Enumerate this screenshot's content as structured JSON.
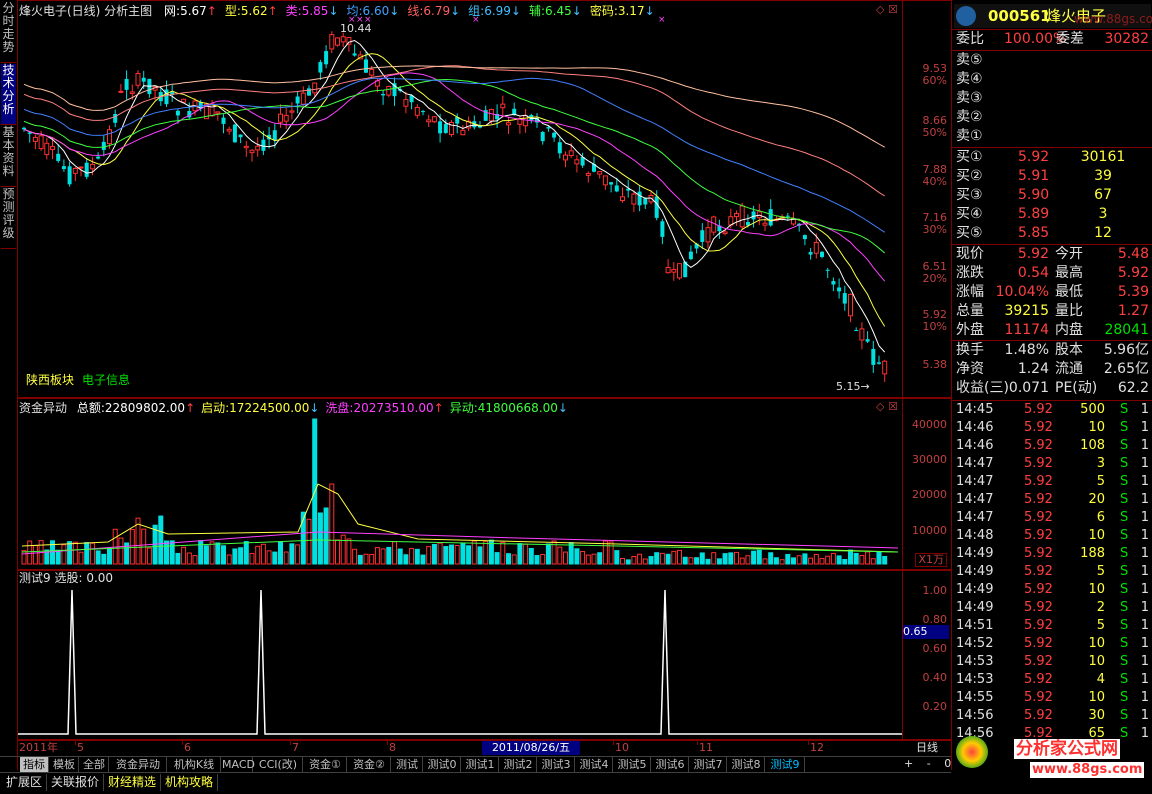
{
  "side_tabs": [
    "分时走势",
    "技术分析",
    "基本资料",
    "预测评级"
  ],
  "header": {
    "title": "烽火电子(日线) 分析主图",
    "items": [
      {
        "label": "网:",
        "value": "5.67",
        "arrow": "↑",
        "color": "#ffffff"
      },
      {
        "label": "型:",
        "value": "5.62",
        "arrow": "↑",
        "color": "#ffff40"
      },
      {
        "label": "类:",
        "value": "5.85",
        "arrow": "↓",
        "color": "#ff40ff"
      },
      {
        "label": "均:",
        "value": "6.60",
        "arrow": "↓",
        "color": "#40a0ff"
      },
      {
        "label": "线:",
        "value": "6.79",
        "arrow": "↓",
        "color": "#ff6060"
      },
      {
        "label": "组:",
        "value": "6.99",
        "arrow": "↓",
        "color": "#40c0ff"
      },
      {
        "label": "辅:",
        "value": "6.45",
        "arrow": "↓",
        "color": "#40ff40"
      },
      {
        "label": "密码:",
        "value": "3.17",
        "arrow": "↓",
        "color": "#ffff40"
      }
    ]
  },
  "main_chart": {
    "high_label": "10.44",
    "low_label": "5.15",
    "sector_label": "陕西板块",
    "industry_label": "电子信息",
    "price_axis": [
      {
        "price": "9.53",
        "pct": "60%"
      },
      {
        "price": "8.66",
        "pct": "50%"
      },
      {
        "price": "7.88",
        "pct": "40%"
      },
      {
        "price": "7.16",
        "pct": "30%"
      },
      {
        "price": "6.51",
        "pct": "20%"
      },
      {
        "price": "5.92",
        "pct": "10%"
      },
      {
        "price": "5.38",
        "pct": ""
      }
    ]
  },
  "volume_chart": {
    "title": "资金异动",
    "items": [
      {
        "label": "总额:",
        "value": "22809802.00",
        "arrow": "↑",
        "color": "#ffffff"
      },
      {
        "label": "启动:",
        "value": "17224500.00",
        "arrow": "↓",
        "color": "#ffff40"
      },
      {
        "label": "洗盘:",
        "value": "20273510.00",
        "arrow": "↑",
        "color": "#ff40ff"
      },
      {
        "label": "异动:",
        "value": "41800668.00",
        "arrow": "↓",
        "color": "#40ff40"
      }
    ],
    "axis": [
      "40000",
      "30000",
      "20000",
      "10000"
    ],
    "unit": "X1万"
  },
  "indicator_chart": {
    "title": "测试9",
    "select_label": "选股:",
    "select_value": "0.00",
    "axis": [
      "1.00",
      "0.80",
      "0.60",
      "0.40",
      "0.20"
    ],
    "cursor_value": "0.65"
  },
  "date_axis": {
    "labels": [
      "2011年",
      "5",
      "6",
      "7",
      "8",
      "10",
      "11",
      "12"
    ],
    "cursor_date": "2011/08/26/五",
    "period": "日线"
  },
  "indicator_tabs": [
    "指标",
    "模板",
    "全部",
    "资金异动",
    "机构K线",
    "MACD",
    "CCI(改)",
    "资金①",
    "资金②",
    "测试",
    "测试0",
    "测试1",
    "测试2",
    "测试3",
    "测试4",
    "测试5",
    "测试6",
    "测试7",
    "测试8",
    "测试9"
  ],
  "active_indicator_tab": "测试9",
  "nav_controls": [
    "+",
    "-",
    "0"
  ],
  "status_tabs": [
    "扩展区",
    "关联报价",
    "财经精选",
    "机构攻略"
  ],
  "quote": {
    "code": "000561",
    "name": "烽火电子",
    "weibi_label": "委比",
    "weibi": "100.00%",
    "weicha_label": "委差",
    "weicha": "30282",
    "sells": [
      {
        "label": "卖⑤",
        "price": "",
        "vol": ""
      },
      {
        "label": "卖④",
        "price": "",
        "vol": ""
      },
      {
        "label": "卖③",
        "price": "",
        "vol": ""
      },
      {
        "label": "卖②",
        "price": "",
        "vol": ""
      },
      {
        "label": "卖①",
        "price": "",
        "vol": ""
      }
    ],
    "buys": [
      {
        "label": "买①",
        "price": "5.92",
        "vol": "30161"
      },
      {
        "label": "买②",
        "price": "5.91",
        "vol": "39"
      },
      {
        "label": "买③",
        "price": "5.90",
        "vol": "67"
      },
      {
        "label": "买④",
        "price": "5.89",
        "vol": "3"
      },
      {
        "label": "买⑤",
        "price": "5.85",
        "vol": "12"
      }
    ],
    "stats": [
      {
        "l1": "现价",
        "v1": "5.92",
        "c1": "red",
        "l2": "今开",
        "v2": "5.48",
        "c2": "red"
      },
      {
        "l1": "涨跌",
        "v1": "0.54",
        "c1": "red",
        "l2": "最高",
        "v2": "5.92",
        "c2": "red"
      },
      {
        "l1": "涨幅",
        "v1": "10.04%",
        "c1": "red",
        "l2": "最低",
        "v2": "5.39",
        "c2": "red"
      },
      {
        "l1": "总量",
        "v1": "39215",
        "c1": "yel",
        "l2": "量比",
        "v2": "1.27",
        "c2": "red"
      },
      {
        "l1": "外盘",
        "v1": "11174",
        "c1": "red",
        "l2": "内盘",
        "v2": "28041",
        "c2": "grn"
      }
    ],
    "fundamentals": [
      {
        "l1": "换手",
        "v1": "1.48%",
        "l2": "股本",
        "v2": "5.96亿"
      },
      {
        "l1": "净资",
        "v1": "1.24",
        "l2": "流通",
        "v2": "2.65亿"
      },
      {
        "l1": "收益(三)",
        "v1": "0.071",
        "l2": "PE(动)",
        "v2": "62.2"
      }
    ],
    "ticks": [
      {
        "time": "14:45",
        "price": "5.92",
        "vol": "500",
        "side": "S",
        "n": "1"
      },
      {
        "time": "14:46",
        "price": "5.92",
        "vol": "10",
        "side": "S",
        "n": "1"
      },
      {
        "time": "14:46",
        "price": "5.92",
        "vol": "108",
        "side": "S",
        "n": "1"
      },
      {
        "time": "14:47",
        "price": "5.92",
        "vol": "3",
        "side": "S",
        "n": "1"
      },
      {
        "time": "14:47",
        "price": "5.92",
        "vol": "5",
        "side": "S",
        "n": "1"
      },
      {
        "time": "14:47",
        "price": "5.92",
        "vol": "20",
        "side": "S",
        "n": "1"
      },
      {
        "time": "14:47",
        "price": "5.92",
        "vol": "6",
        "side": "S",
        "n": "1"
      },
      {
        "time": "14:48",
        "price": "5.92",
        "vol": "10",
        "side": "S",
        "n": "1"
      },
      {
        "time": "14:49",
        "price": "5.92",
        "vol": "188",
        "side": "S",
        "n": "1"
      },
      {
        "time": "14:49",
        "price": "5.92",
        "vol": "5",
        "side": "S",
        "n": "1"
      },
      {
        "time": "14:49",
        "price": "5.92",
        "vol": "10",
        "side": "S",
        "n": "1"
      },
      {
        "time": "14:49",
        "price": "5.92",
        "vol": "2",
        "side": "S",
        "n": "1"
      },
      {
        "time": "14:51",
        "price": "5.92",
        "vol": "5",
        "side": "S",
        "n": "1"
      },
      {
        "time": "14:52",
        "price": "5.92",
        "vol": "10",
        "side": "S",
        "n": "1"
      },
      {
        "time": "14:53",
        "price": "5.92",
        "vol": "10",
        "side": "S",
        "n": "1"
      },
      {
        "time": "14:53",
        "price": "5.92",
        "vol": "4",
        "side": "S",
        "n": "1"
      },
      {
        "time": "14:55",
        "price": "5.92",
        "vol": "10",
        "side": "S",
        "n": "1"
      },
      {
        "time": "14:56",
        "price": "5.92",
        "vol": "30",
        "side": "S",
        "n": "1"
      },
      {
        "time": "14:56",
        "price": "5.92",
        "vol": "65",
        "side": "S",
        "n": "1"
      }
    ]
  },
  "watermark": {
    "cn": "分析家公式网",
    "url": "www.88gs.com",
    "top_url": "www.88gs.com"
  }
}
